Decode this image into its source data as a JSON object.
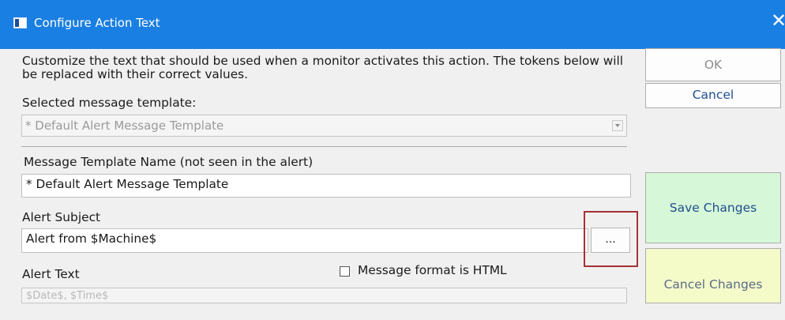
{
  "window": {
    "title": "Configure Action Text",
    "icon": "window-app-icon",
    "close": "close-icon",
    "accent": "#1a7fe2"
  },
  "description": "Customize the text that should be used when a monitor activates this action.  The tokens below will be replaced with their correct values.",
  "template_select": {
    "label": "Selected message template:",
    "value": "* Default Alert Message Template",
    "icon": "dropdown-arrow-icon"
  },
  "template_name": {
    "label": "Message Template Name (not seen in the alert)",
    "value": "* Default Alert Message Template"
  },
  "alert_subject": {
    "label": "Alert Subject",
    "value": "Alert from $Machine$",
    "browse_label": "..."
  },
  "alert_text": {
    "label": "Alert Text",
    "value": "$Date$, $Time$"
  },
  "html_checkbox": {
    "label": "Message format is HTML",
    "checked": false
  },
  "buttons": {
    "ok": "OK",
    "cancel": "Cancel",
    "save": "Save Changes",
    "cancel_changes": "Cancel Changes"
  },
  "colors": {
    "save_bg": "#d6f7d8",
    "cancel_changes_bg": "#f4fbc9",
    "highlight": "#a73135"
  }
}
